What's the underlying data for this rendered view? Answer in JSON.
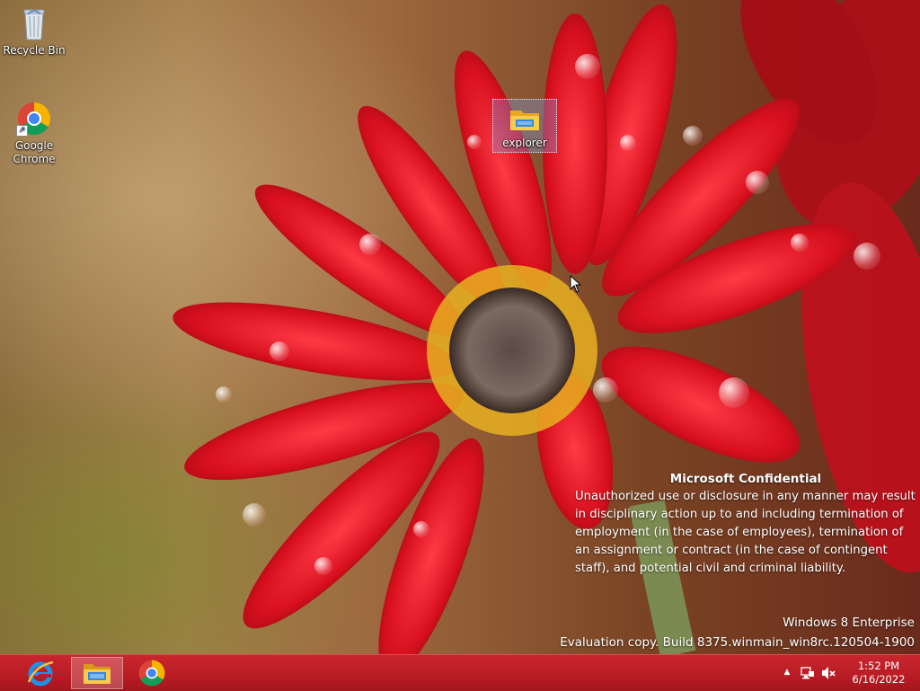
{
  "desktop": {
    "icons": [
      {
        "label": "Recycle Bin",
        "icon": "recycle-bin-icon"
      },
      {
        "label": "Google Chrome",
        "icon": "chrome-icon"
      },
      {
        "label": "explorer",
        "icon": "folder-icon"
      }
    ]
  },
  "watermark": {
    "title": "Microsoft Confidential",
    "lines": [
      "Unauthorized use or disclosure in any manner may result",
      "in disciplinary action up to and including termination of",
      "employment (in the case of employees), termination of",
      "an assignment or contract (in the case of contingent",
      "staff), and potential civil and criminal liability."
    ]
  },
  "build": {
    "edition": "Windows 8 Enterprise",
    "copy": "Evaluation copy. Build 8375.winmain_win8rc.120504-1900"
  },
  "taskbar": {
    "pinned": [
      {
        "name": "Internet Explorer",
        "icon": "internet-explorer-icon"
      },
      {
        "name": "File Explorer",
        "icon": "file-explorer-icon",
        "active": true
      },
      {
        "name": "Google Chrome",
        "icon": "chrome-icon"
      }
    ],
    "tray": {
      "show_hidden": "▲",
      "icons": [
        "network-icon",
        "volume-muted-icon"
      ]
    },
    "clock": {
      "time": "1:52 PM",
      "date": "6/16/2022"
    }
  },
  "colors": {
    "taskbar": "#b81c24",
    "accent_folder": "#f4c542",
    "petal_red": "#d8101e"
  }
}
